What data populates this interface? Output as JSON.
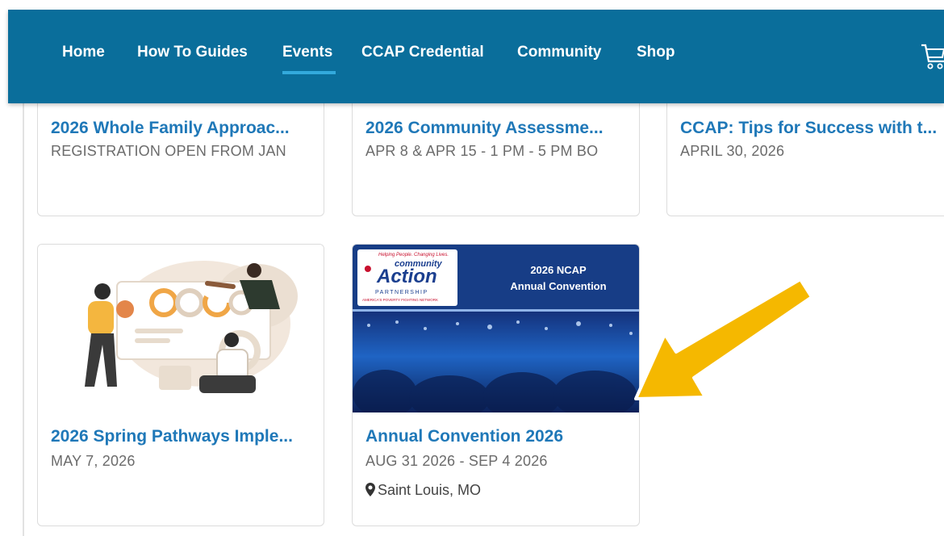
{
  "nav": {
    "items": [
      "Home",
      "How To Guides",
      "Events",
      "CCAP Credential",
      "Community",
      "Shop"
    ],
    "active": "Events"
  },
  "cards": [
    {
      "title": "2026 Whole Family Approac...",
      "date": "REGISTRATION OPEN FROM JAN"
    },
    {
      "title": "2026 Community Assessme...",
      "date": "APR 8 & APR 15 - 1 PM - 5 PM BO"
    },
    {
      "title": "CCAP: Tips for Success with t...",
      "date": "APRIL 30, 2026"
    },
    {
      "title": "2026 Spring Pathways Imple...",
      "date": "MAY 7, 2026"
    },
    {
      "title": "Annual Convention 2026",
      "date": "AUG 31 2026 - SEP 4 2026",
      "location": "Saint Louis, MO"
    }
  ],
  "convention_banner": {
    "logo_tagline": "Helping People. Changing Lives.",
    "logo_line1": "community",
    "logo_line2": "Action",
    "logo_line3": "PARTNERSHIP",
    "logo_line4": "AMERICA'S POVERTY FIGHTING NETWORK",
    "heading1": "2026 NCAP",
    "heading2": "Annual Convention"
  },
  "colors": {
    "nav_bg": "#0a6e9b",
    "nav_active_underline": "#33a9dc",
    "card_title": "#1f78b8",
    "arrow": "#f5b800"
  },
  "icons": [
    "cart-icon",
    "map-pin-icon",
    "arrow-annotation"
  ]
}
